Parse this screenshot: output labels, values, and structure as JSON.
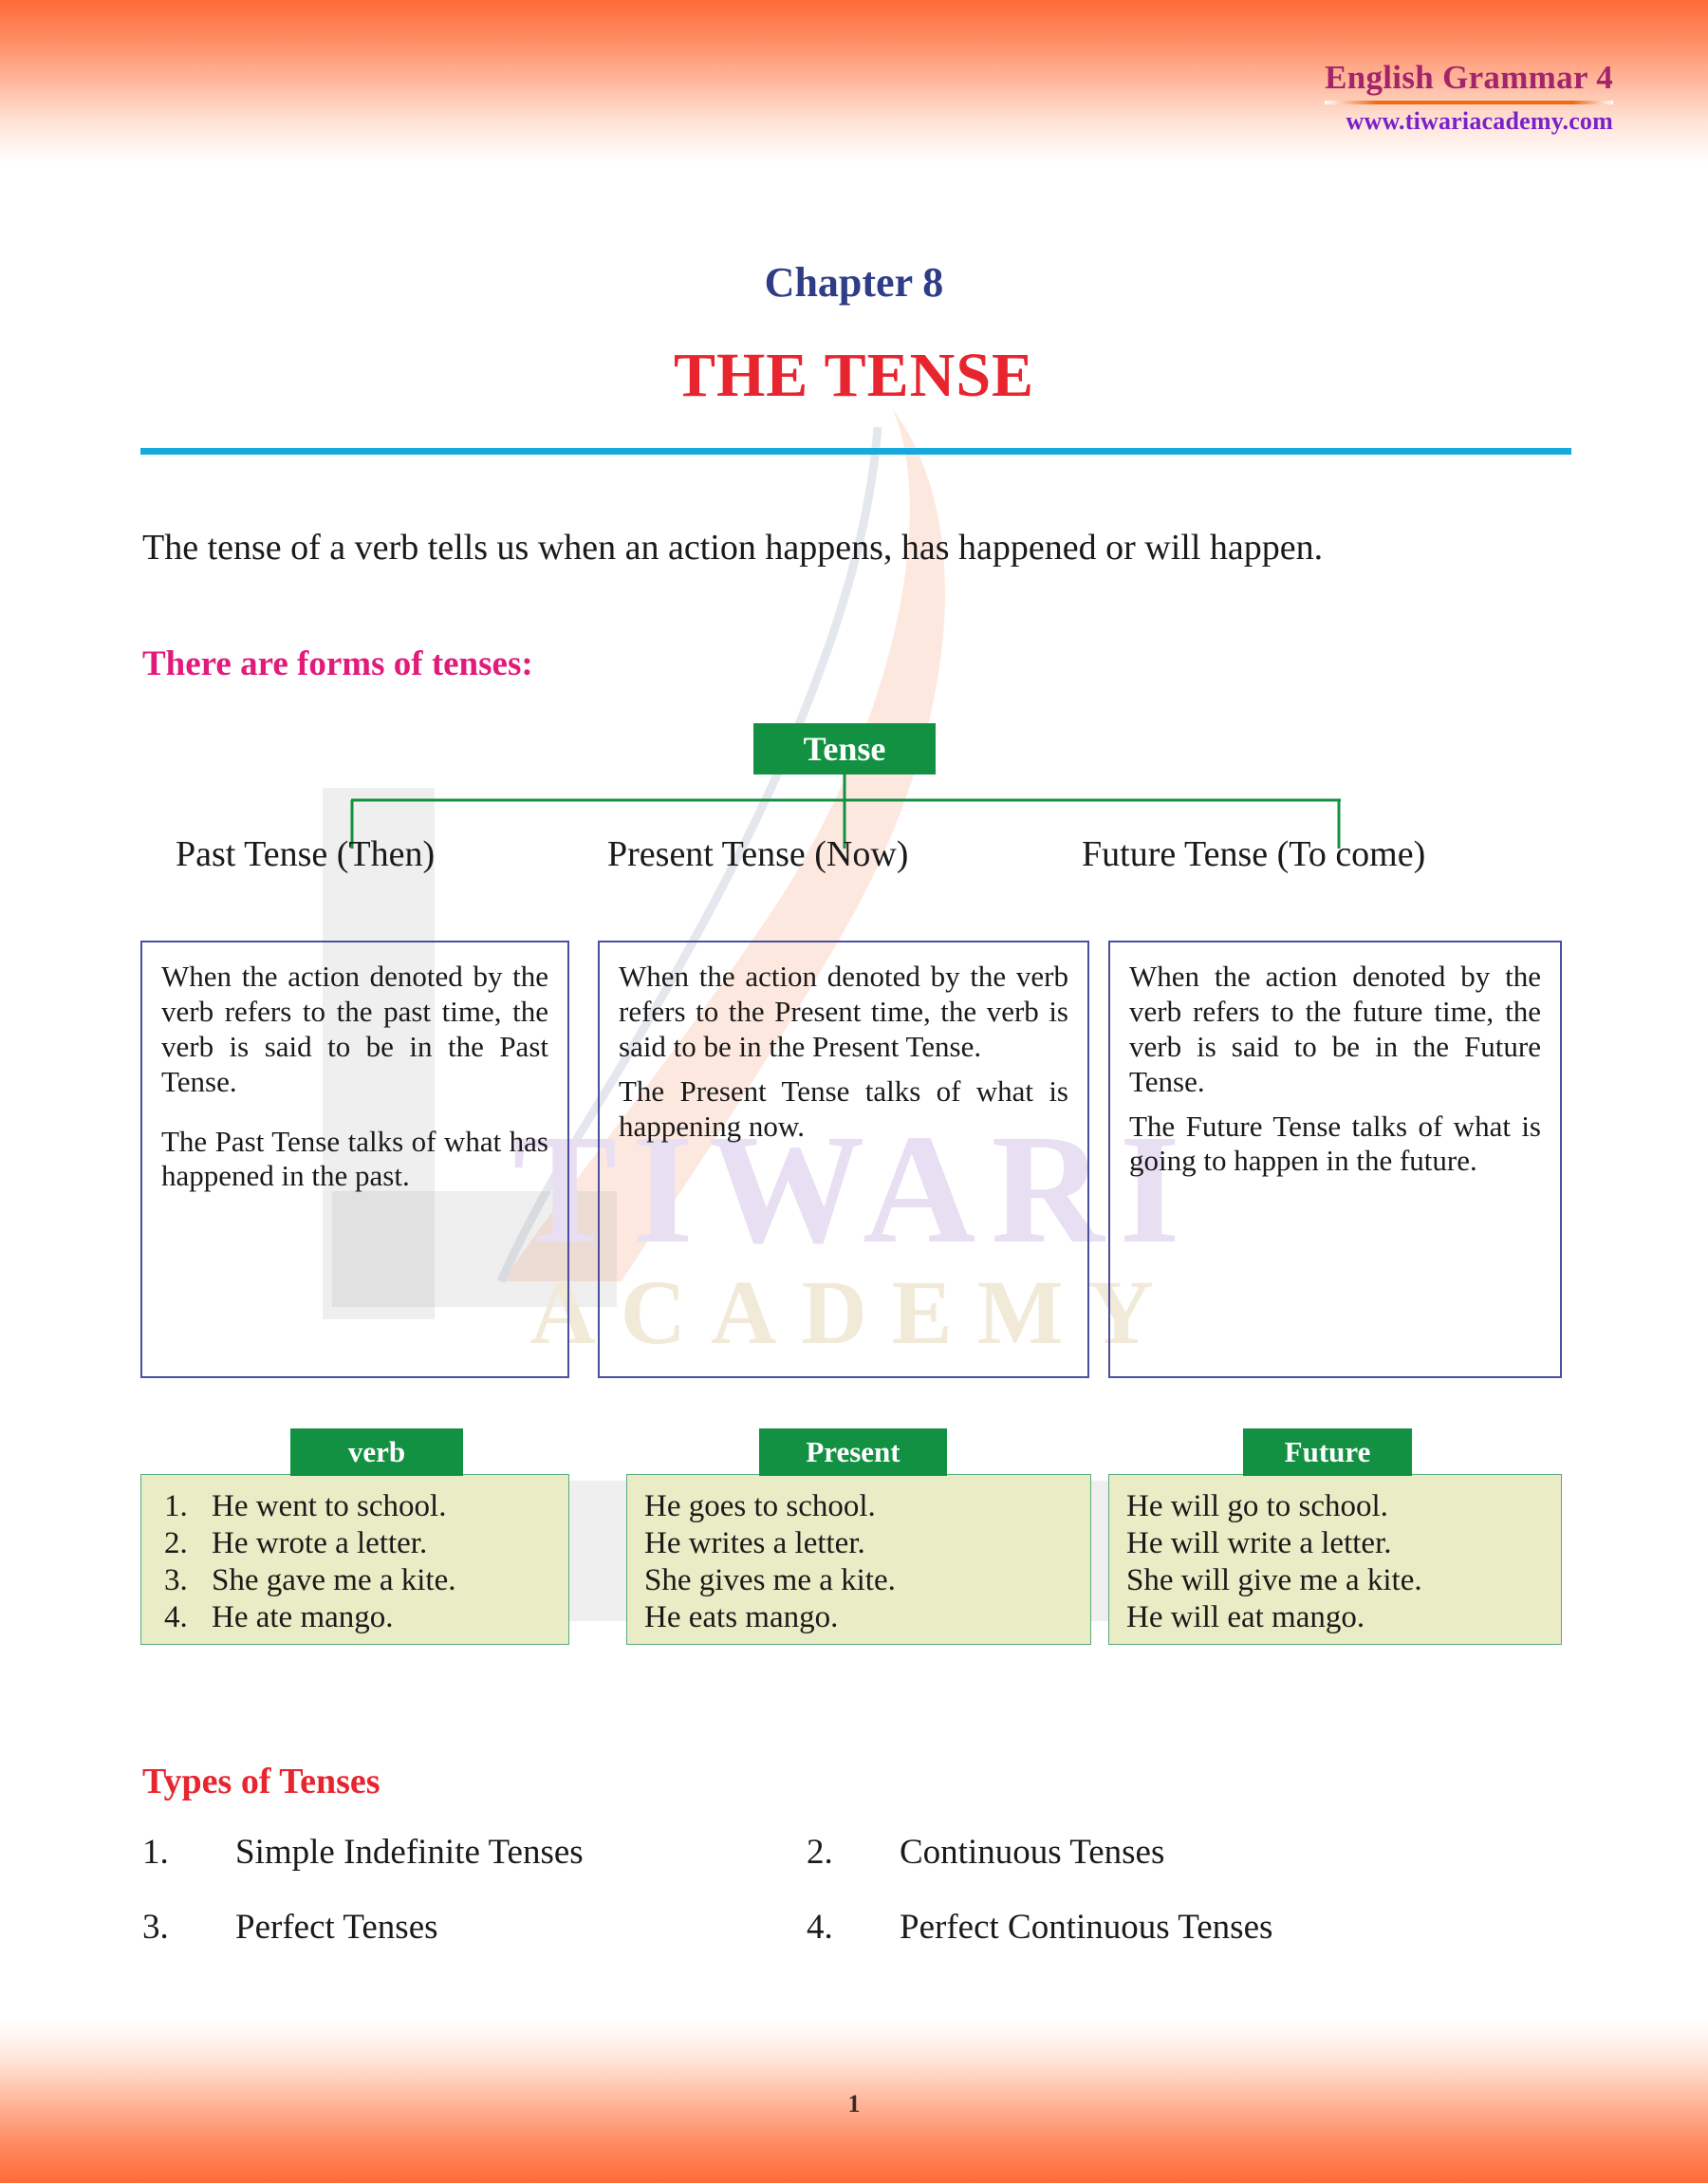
{
  "header": {
    "book_title": "English Grammar 4",
    "website": "www.tiwariacademy.com",
    "accent_title_color": "#a4246a",
    "accent_url_color": "#7b20c9",
    "rule_color": "#f06a12"
  },
  "title_block": {
    "chapter": "Chapter 8",
    "title": "THE TENSE",
    "chapter_color": "#2f3d87",
    "title_color": "#e8252f",
    "rule_color": "#14aade"
  },
  "intro": {
    "paragraph": "The tense of a verb tells us when an action happens, has happened or will happen.",
    "subheading": "There are forms of tenses:",
    "subheading_color": "#e21b7b"
  },
  "tree": {
    "root_label": "Tense",
    "root_color": "#139143",
    "line_color": "#139143",
    "branches": [
      "Past Tense (Then)",
      "Present Tense (Now)",
      "Future Tense (To come)"
    ]
  },
  "definitions": [
    {
      "para1": "When the action denoted by the verb refers to the past time, the verb is said to be in the Past Tense.",
      "para2": "The Past Tense talks of what has happened in the past."
    },
    {
      "para1": "When the action denoted by the verb refers to the Present time, the verb is said to be in the Present Tense.",
      "para2": "The Present Tense talks of what is happening now."
    },
    {
      "para1": "When the action denoted by the verb refers to the future time, the verb is said to be in the Future Tense.",
      "para2": "The Future Tense talks of what is going to happen in the future."
    }
  ],
  "examples": {
    "tab_color": "#139143",
    "body_color": "#e9ecc4",
    "columns": [
      {
        "tab_label": "verb",
        "numbered": true,
        "numbers": [
          "1.",
          "2.",
          "3.",
          "4."
        ],
        "items": [
          "He went to school.",
          "He wrote a letter.",
          "She gave me a kite.",
          "He ate mango."
        ]
      },
      {
        "tab_label": "Present",
        "numbered": false,
        "items": [
          "He goes to school.",
          "He writes a letter.",
          "She gives me a kite.",
          "He eats mango."
        ]
      },
      {
        "tab_label": "Future",
        "numbered": false,
        "items": [
          "He will go to school.",
          "He will write a letter.",
          "She will give me a kite.",
          "He will eat mango."
        ]
      }
    ]
  },
  "types_of_tenses": {
    "heading": "Types of Tenses",
    "heading_color": "#e8252f",
    "items": [
      {
        "number": "1.",
        "label": "Simple Indefinite Tenses"
      },
      {
        "number": "2.",
        "label": "Continuous Tenses"
      },
      {
        "number": "3.",
        "label": "Perfect Tenses"
      },
      {
        "number": "4.",
        "label": "Perfect Continuous Tenses"
      }
    ]
  },
  "watermark": {
    "line1": "TIWARI",
    "line2": "ACADEMY"
  },
  "footer": {
    "page_number": "1"
  }
}
